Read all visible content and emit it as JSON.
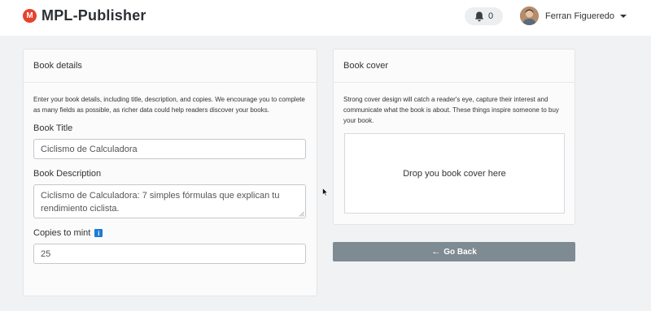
{
  "app": {
    "name": "MPL-Publisher",
    "logo_letter": "M",
    "brand_color": "#e8412c"
  },
  "navbar": {
    "notification_count": "0",
    "user_name": "Ferran Figueredo"
  },
  "book_details": {
    "header": "Book details",
    "intro": "Enter your book details, including title, description, and copies. We encourage you to complete as many fields as possible, as richer data could help readers discover your books.",
    "title_label": "Book Title",
    "title_value": "Ciclismo de Calculadora",
    "description_label": "Book Description",
    "description_value": "Ciclismo de Calculadora: 7 simples fórmulas que explican tu rendimiento ciclista.",
    "copies_label": "Copies to mint",
    "copies_value": "25",
    "info_icon_glyph": "i"
  },
  "book_cover": {
    "header": "Book cover",
    "intro": "Strong cover design will catch a reader's eye, capture their interest and communicate what the book is about. These things inspire someone to buy your book.",
    "dropzone_text": "Drop you book cover here"
  },
  "actions": {
    "back_arrow": "←",
    "back_label": "Go Back",
    "back_color": "#7f8b93"
  },
  "icons": [
    "logo-icon",
    "bell-icon",
    "avatar",
    "caret-down-icon",
    "info-icon",
    "arrow-left-icon",
    "mouse-cursor-icon",
    "resize-handle-icon"
  ]
}
